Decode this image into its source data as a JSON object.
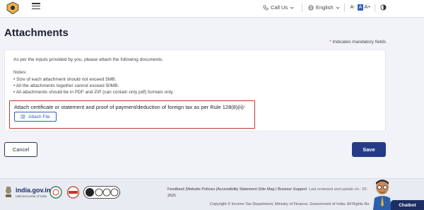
{
  "header": {
    "call_us": "Call Us",
    "language": "English",
    "font_decrease": "A-",
    "font_normal": "A",
    "font_increase": "A+"
  },
  "page": {
    "title": "Attachments",
    "mandatory_note": "Indicates mandatory fields",
    "mandatory_star": "*"
  },
  "card": {
    "intro": "As per the inputs provided by you, please attach the following documents.",
    "notes_title": "Notes:",
    "notes": [
      "Size of each attachment should not exceed 5MB.",
      "All the attachments together cannot exceed 50MB.",
      "All attachments should be in PDF and ZIP (can contain only pdf) formats only."
    ],
    "attach_label": "Attach certificate or statement and proof of payment/deduction of foreign tax as per Rule 128(8)(ii)",
    "attach_star": "*",
    "attach_button": "Attach File"
  },
  "actions": {
    "cancel": "Cancel",
    "save": "Save"
  },
  "footer": {
    "site_name": "india.gov.in",
    "site_tagline": "national portal of india",
    "links": [
      "Feedback",
      "Website Policies",
      "Accessibility Statement",
      "Site Map",
      "Browser Support"
    ],
    "updated_text": "Last reviewed and update on : 25-",
    "updated_year": "2021",
    "copyright": "Copyright © Income Tax Department, Ministry of Finance, Government of India. All Rights Re"
  },
  "chatbot": {
    "label": "Chatbot"
  },
  "colors": {
    "primary": "#243a86",
    "accent": "#2c5dbf",
    "error": "#c0392b"
  }
}
